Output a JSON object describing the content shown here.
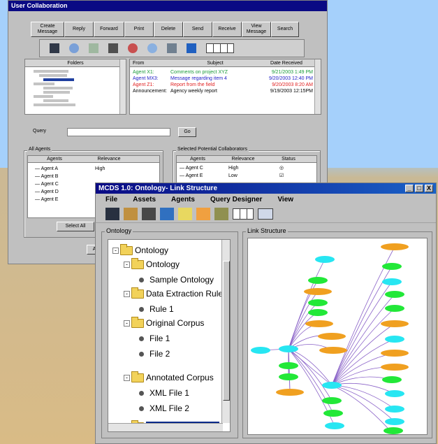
{
  "win1": {
    "title": "User Collaboration",
    "toolbar": [
      {
        "name": "create-message-button",
        "label": "Create Message",
        "w": 48
      },
      {
        "name": "reply-button",
        "label": "Reply",
        "w": 42
      },
      {
        "name": "forward-button",
        "label": "Forward",
        "w": 44
      },
      {
        "name": "print-button",
        "label": "Print",
        "w": 42
      },
      {
        "name": "delete-button",
        "label": "Delete",
        "w": 42
      },
      {
        "name": "send-button",
        "label": "Send",
        "w": 42
      },
      {
        "name": "receive-button",
        "label": "Receive",
        "w": 42
      },
      {
        "name": "view-message-button",
        "label": "View Message",
        "w": 42
      },
      {
        "name": "search-button",
        "label": "Search",
        "w": 40
      }
    ],
    "folders_header": "Folders",
    "messages": {
      "headers": {
        "from": "From",
        "subject": "Subject",
        "date": "Date Received"
      },
      "rows": [
        {
          "from": "Agent X1:",
          "subject": "Comments on project XYZ",
          "date": "9/21/2003 1:49 PM",
          "color": "#1a9a3a"
        },
        {
          "from": "Agent MX3:",
          "subject": "Message regarding item 4",
          "date": "9/20/2003 12:40 PM",
          "color": "#2020c8"
        },
        {
          "from": "Agent Z1:",
          "subject": "Report from the field",
          "date": "9/20/2003 8:20 AM",
          "color": "#e02020"
        },
        {
          "from": "Announcement:",
          "subject": "Agency weekly report",
          "date": "9/19/2003 12:15PM",
          "color": "#000000"
        }
      ]
    },
    "query_label": "Query",
    "query_value": "",
    "go_label": "Go",
    "all_agents": {
      "label": "All Agents",
      "headers": {
        "agents": "Agents",
        "relevance": "Relevance"
      },
      "rows": [
        {
          "agent": "Agent A",
          "relevance": "High"
        },
        {
          "agent": "Agent B",
          "relevance": ""
        },
        {
          "agent": "Agent C",
          "relevance": ""
        },
        {
          "agent": "Agent D",
          "relevance": ""
        },
        {
          "agent": "Agent E",
          "relevance": ""
        }
      ]
    },
    "selected": {
      "label": "Selected Potential Collaborators",
      "headers": {
        "agents": "Agents",
        "relevance": "Relevance",
        "status": "Status"
      },
      "rows": [
        {
          "agent": "Agent C",
          "relevance": "High"
        },
        {
          "agent": "Agent E",
          "relevance": "Low"
        }
      ]
    },
    "select_all_label": "Select All",
    "add_label": "Add"
  },
  "win2": {
    "title": "MCDS 1.0: Ontology- Link Structure",
    "window_controls": [
      "_",
      "□",
      "X"
    ],
    "menu": [
      "File",
      "Assets",
      "Agents",
      "Query Designer",
      "View"
    ],
    "ontology_label": "Ontology",
    "link_label": "Link Structure",
    "tree": [
      {
        "label": "Ontology",
        "type": "folder",
        "pm": "-"
      },
      {
        "label": "Ontology",
        "type": "folder",
        "pm": "-"
      },
      {
        "label": "Sample Ontology",
        "type": "leaf"
      },
      {
        "label": "Data Extraction Rules",
        "type": "folder",
        "pm": "-"
      },
      {
        "label": "Rule 1",
        "type": "leaf"
      },
      {
        "label": "Original Corpus",
        "type": "folder",
        "pm": "-"
      },
      {
        "label": "File 1",
        "type": "leaf"
      },
      {
        "label": "File 2",
        "type": "leaf"
      },
      {
        "label": "Annotated Corpus",
        "type": "folder",
        "pm": "-"
      },
      {
        "label": "XML File 1",
        "type": "leaf"
      },
      {
        "label": "XML File 2",
        "type": "leaf"
      },
      {
        "label": "Ontology Instances",
        "type": "folder",
        "pm": "-",
        "selected": true
      }
    ]
  },
  "colors": {
    "cyan": "#27e6f2",
    "green": "#22e838",
    "orange": "#f0a020",
    "edge": "#8a62c8"
  }
}
